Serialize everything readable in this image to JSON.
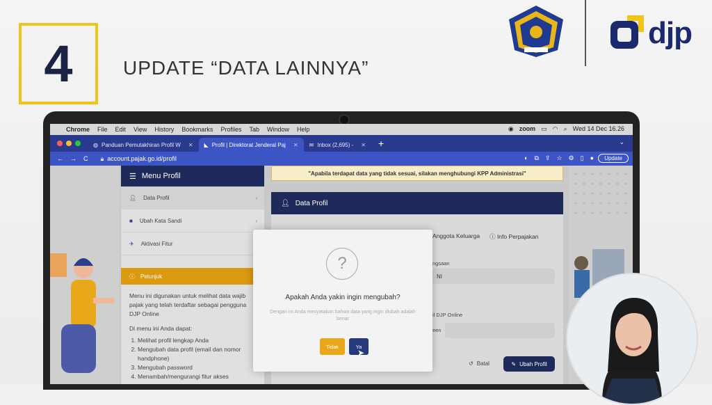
{
  "slide": {
    "step": "4",
    "title": "UPDATE “DATA LAINNYA”",
    "logo_text": "djp"
  },
  "macbar": {
    "app": "Chrome",
    "menus": [
      "File",
      "Edit",
      "View",
      "History",
      "Bookmarks",
      "Profiles",
      "Tab",
      "Window",
      "Help"
    ],
    "zoom": "zoom",
    "datetime": "Wed 14 Dec 16.26"
  },
  "browser": {
    "tabs": [
      {
        "label": "Panduan Pemutakhiran Profil W"
      },
      {
        "label": "Profil | Direktorat Jenderal Paj"
      },
      {
        "label": "Inbox (2,695) -"
      }
    ],
    "url": "account.pajak.go.id/profil",
    "update_label": "Update"
  },
  "sidebar": {
    "menu_title": "Menu Profil",
    "items": [
      {
        "label": "Data Profil"
      },
      {
        "label": "Ubah Kata Sandi"
      },
      {
        "label": "Aktivasi Fitur"
      }
    ],
    "help_title": "Petunjuk",
    "help_text1": "Menu ini digunakan untuk melihat data wajib pajak yang telah terdaftar sebagai pengguna DJP Online",
    "help_text2": "Di menu ini Anda dapat:",
    "help_list": [
      "Melihat profil lengkap Anda",
      "Mengubah data profil (email dan nomor handphone)",
      "Mengubah password",
      "Menambah/mengurangi fitur akses"
    ]
  },
  "main": {
    "notice": "\"Apabila terdapat data yang tidak sesuai, silakan menghubungi KPP Administrasi\"",
    "section_title": "Data Profil",
    "tab_keluarga": "Anggota Keluarga",
    "tab_info": "Info Perpajakan",
    "field1_label": "ngsaan",
    "field1_value": "NI",
    "field2_label": "il DJP Online",
    "field3_label": "een",
    "batal": "Batal",
    "ubah_profil": "Ubah Profil"
  },
  "modal": {
    "icon": "?",
    "title": "Apakah Anda yakin ingin mengubah?",
    "desc": "Dengan ini Anda menyatakan bahwa data yang ingin diubah adalah benar",
    "btn_no": "Tidak",
    "btn_yes": "Ya"
  },
  "colors": {
    "accent_yellow": "#f0c419",
    "navy": "#1e2a5a",
    "chrome_blue": "#3d55c4",
    "orange": "#e8a81a"
  }
}
